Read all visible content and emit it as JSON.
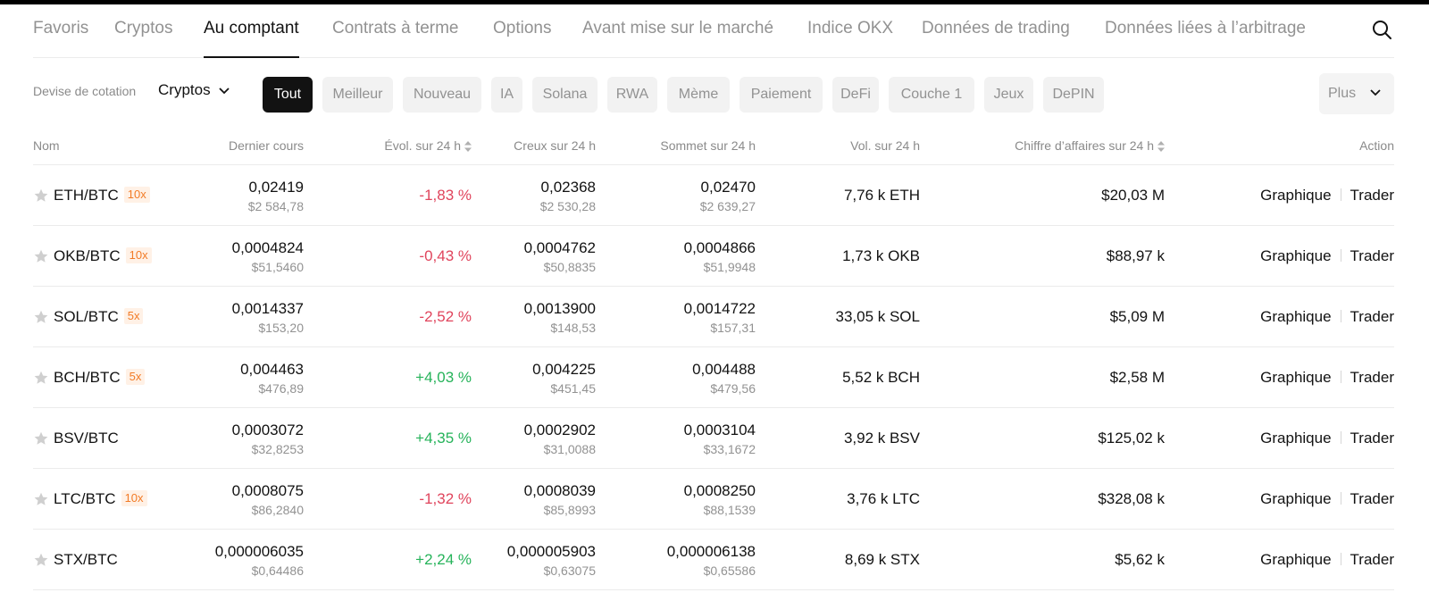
{
  "tabs": [
    {
      "label": "Favoris",
      "active": false
    },
    {
      "label": "Cryptos",
      "active": false
    },
    {
      "label": "Au comptant",
      "active": true
    },
    {
      "label": "Contrats à terme",
      "active": false
    },
    {
      "label": "Options",
      "active": false
    },
    {
      "label": "Avant mise sur le marché",
      "active": false
    },
    {
      "label": "Indice OKX",
      "active": false
    },
    {
      "label": "Données de trading",
      "active": false
    },
    {
      "label": "Données liées à l’arbitrage",
      "active": false
    }
  ],
  "search_icon": "search-icon",
  "filters": {
    "quote_label": "Devise de cotation",
    "quote_value": "Cryptos",
    "chips": [
      {
        "label": "Tout",
        "active": true
      },
      {
        "label": "Meilleur",
        "active": false
      },
      {
        "label": "Nouveau",
        "active": false
      },
      {
        "label": "IA",
        "active": false
      },
      {
        "label": "Solana",
        "active": false
      },
      {
        "label": "RWA",
        "active": false
      },
      {
        "label": "Mème",
        "active": false
      },
      {
        "label": "Paiement",
        "active": false
      },
      {
        "label": "DeFi",
        "active": false
      },
      {
        "label": "Couche 1",
        "active": false
      },
      {
        "label": "Jeux",
        "active": false
      },
      {
        "label": "DePIN",
        "active": false
      }
    ],
    "more_label": "Plus"
  },
  "table": {
    "headers": {
      "name": "Nom",
      "last": "Dernier cours",
      "change": "Évol. sur 24 h",
      "low": "Creux sur 24 h",
      "high": "Sommet sur 24 h",
      "volume": "Vol. sur 24 h",
      "turnover": "Chiffre d’affaires sur 24 h",
      "action": "Action"
    },
    "action_chart": "Graphique",
    "action_trade": "Trader",
    "rows": [
      {
        "pair": "ETH/BTC",
        "leverage": "10x",
        "last": "0,02419",
        "last_usd": "$2 584,78",
        "change": "-1,83 %",
        "direction": "down",
        "low": "0,02368",
        "low_usd": "$2 530,28",
        "high": "0,02470",
        "high_usd": "$2 639,27",
        "volume": "7,76 k ETH",
        "turnover": "$20,03 M"
      },
      {
        "pair": "OKB/BTC",
        "leverage": "10x",
        "last": "0,0004824",
        "last_usd": "$51,5460",
        "change": "-0,43 %",
        "direction": "down",
        "low": "0,0004762",
        "low_usd": "$50,8835",
        "high": "0,0004866",
        "high_usd": "$51,9948",
        "volume": "1,73 k OKB",
        "turnover": "$88,97 k"
      },
      {
        "pair": "SOL/BTC",
        "leverage": "5x",
        "last": "0,0014337",
        "last_usd": "$153,20",
        "change": "-2,52 %",
        "direction": "down",
        "low": "0,0013900",
        "low_usd": "$148,53",
        "high": "0,0014722",
        "high_usd": "$157,31",
        "volume": "33,05 k SOL",
        "turnover": "$5,09 M"
      },
      {
        "pair": "BCH/BTC",
        "leverage": "5x",
        "last": "0,004463",
        "last_usd": "$476,89",
        "change": "+4,03 %",
        "direction": "up",
        "low": "0,004225",
        "low_usd": "$451,45",
        "high": "0,004488",
        "high_usd": "$479,56",
        "volume": "5,52 k BCH",
        "turnover": "$2,58 M"
      },
      {
        "pair": "BSV/BTC",
        "leverage": "",
        "last": "0,0003072",
        "last_usd": "$32,8253",
        "change": "+4,35 %",
        "direction": "up",
        "low": "0,0002902",
        "low_usd": "$31,0088",
        "high": "0,0003104",
        "high_usd": "$33,1672",
        "volume": "3,92 k BSV",
        "turnover": "$125,02 k"
      },
      {
        "pair": "LTC/BTC",
        "leverage": "10x",
        "last": "0,0008075",
        "last_usd": "$86,2840",
        "change": "-1,32 %",
        "direction": "down",
        "low": "0,0008039",
        "low_usd": "$85,8993",
        "high": "0,0008250",
        "high_usd": "$88,1539",
        "volume": "3,76 k LTC",
        "turnover": "$328,08 k"
      },
      {
        "pair": "STX/BTC",
        "leverage": "",
        "last": "0,000006035",
        "last_usd": "$0,64486",
        "change": "+2,24 %",
        "direction": "up",
        "low": "0,000005903",
        "low_usd": "$0,63075",
        "high": "0,000006138",
        "high_usd": "$0,65586",
        "volume": "8,69 k STX",
        "turnover": "$5,62 k"
      }
    ]
  },
  "colors": {
    "positive": "#26b35a",
    "negative": "#e0445c",
    "leverage": "#f27b26",
    "active_chip": "#121212"
  }
}
